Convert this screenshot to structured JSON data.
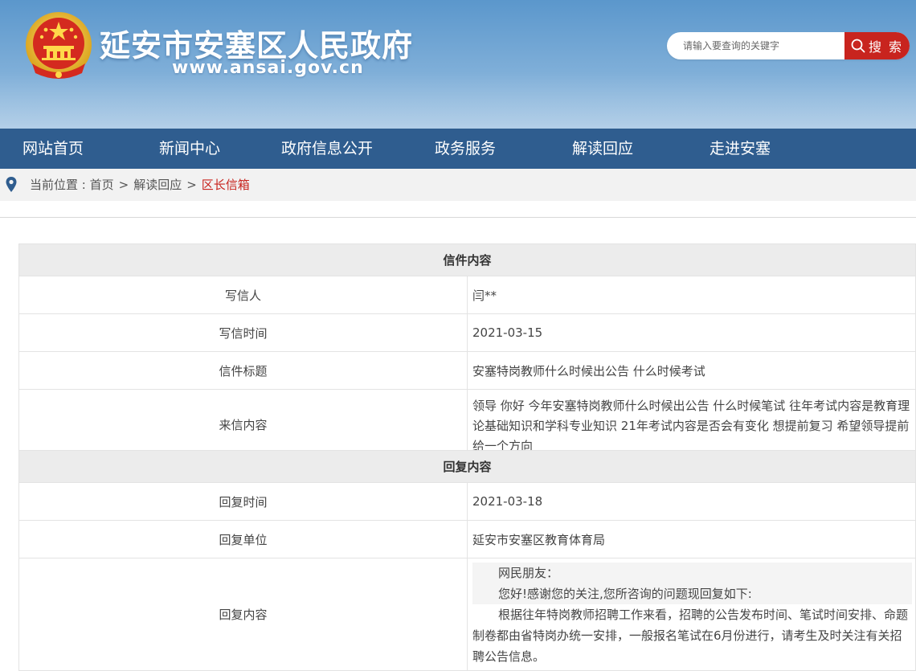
{
  "header": {
    "title": "延安市安塞区人民政府",
    "url": "www.ansai.gov.cn",
    "search": {
      "placeholder": "请输入要查询的关键字",
      "button_label": "搜 索"
    }
  },
  "nav": {
    "items": [
      {
        "label": "网站首页"
      },
      {
        "label": "新闻中心"
      },
      {
        "label": "政府信息公开"
      },
      {
        "label": "政务服务"
      },
      {
        "label": "解读回应"
      },
      {
        "label": "走进安塞"
      }
    ]
  },
  "breadcrumb": {
    "prefix": "当前位置 : ",
    "items": [
      "首页",
      "解读回应",
      "区长信箱"
    ],
    "separator": ">"
  },
  "letter": {
    "heading": "信件内容",
    "rows": [
      {
        "label": "写信人",
        "value": "闫**"
      },
      {
        "label": "写信时间",
        "value": "2021-03-15"
      },
      {
        "label": "信件标题",
        "value": "安塞特岗教师什么时候出公告 什么时候考试"
      },
      {
        "label": "来信内容",
        "value": "领导 你好 今年安塞特岗教师什么时候出公告 什么时候笔试 往年考试内容是教育理论基础知识和学科专业知识 21年考试内容是否会有变化 想提前复习 希望领导提前给一个方向"
      }
    ]
  },
  "reply": {
    "heading": "回复内容",
    "rows": [
      {
        "label": "回复时间",
        "value": "2021-03-18"
      },
      {
        "label": "回复单位",
        "value": "延安市安塞区教育体育局"
      }
    ],
    "content_label": "回复内容",
    "content": {
      "greeting": "网民朋友：",
      "intro": "您好!感谢您的关注,您所咨询的问题现回复如下:",
      "body": "根据往年特岗教师招聘工作来看，招聘的公告发布时间、笔试时间安排、命题制卷都由省特岗办统一安排，一般报名笔试在6月份进行，请考生及时关注有关招聘公告信息。"
    }
  },
  "colors": {
    "nav_bg": "#2f5d8f",
    "accent_red": "#c8241e",
    "header_blue": "#6ea3d2"
  }
}
